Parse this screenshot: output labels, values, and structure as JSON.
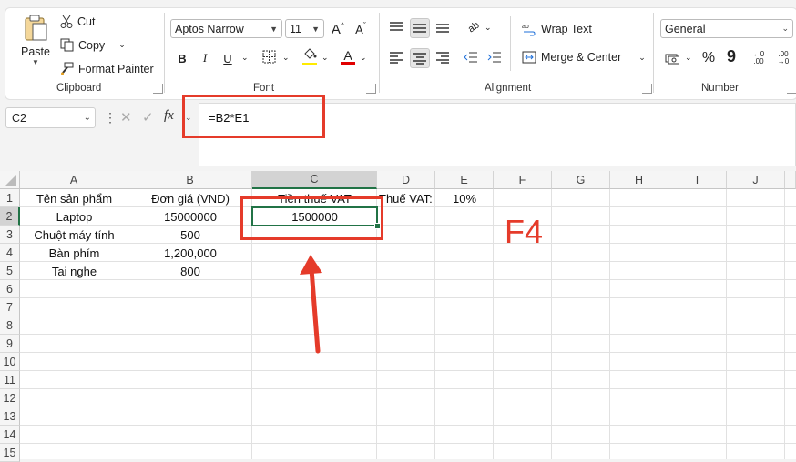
{
  "clipboard": {
    "paste_label": "Paste",
    "cut_label": "Cut",
    "copy_label": "Copy",
    "format_painter_label": "Format Painter",
    "group_label": "Clipboard"
  },
  "font": {
    "font_name": "Aptos Narrow",
    "font_size": "11",
    "grow_label": "A",
    "shrink_label": "A",
    "bold_label": "B",
    "italic_label": "I",
    "underline_label": "U",
    "font_color_label": "A",
    "group_label": "Font"
  },
  "alignment": {
    "wrap_text_label": "Wrap Text",
    "merge_center_label": "Merge & Center",
    "group_label": "Alignment"
  },
  "number": {
    "format": "General",
    "percent_label": "%",
    "comma_label": "9",
    "group_label": "Number"
  },
  "formula_bar": {
    "name_box": "C2",
    "fx_label": "fx",
    "formula": "=B2*E1"
  },
  "columns": [
    "A",
    "B",
    "C",
    "D",
    "E",
    "F",
    "G",
    "H",
    "I",
    "J"
  ],
  "rows": [
    "1",
    "2",
    "3",
    "4",
    "5",
    "6",
    "7",
    "8",
    "9",
    "10",
    "11",
    "12",
    "13",
    "14",
    "15"
  ],
  "cells": {
    "A1": "Tên sản phẩm",
    "B1": "Đơn giá (VND)",
    "C1": "Tiền thuế VAT",
    "D1": "Thuế VAT:",
    "E1": "10%",
    "A2": "Laptop",
    "B2": "15000000",
    "C2": "1500000",
    "A3": "Chuột máy tính",
    "B3": "500",
    "A4": "Bàn phím",
    "B4": "1,200,000",
    "A5": "Tai nghe",
    "B5": "800"
  },
  "annotation": {
    "key_label": "F4",
    "highlight_color": "#e53b2a"
  },
  "colors": {
    "active_cell_border": "#217346",
    "font_color_underline": "#e00000",
    "fill_color_underline": "#ffeb00"
  }
}
